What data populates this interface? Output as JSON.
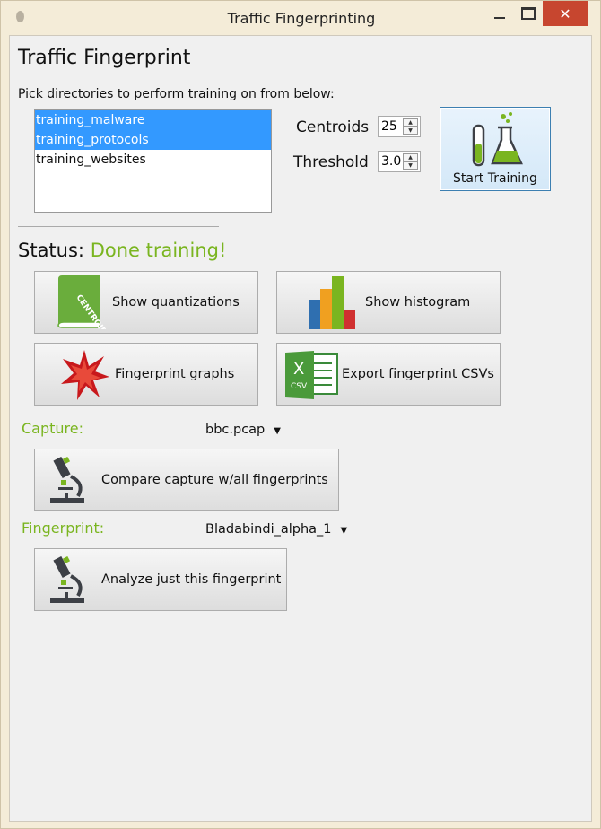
{
  "window": {
    "title": "Traffic Fingerprinting",
    "controls": {
      "minimize": "minimize",
      "maximize": "maximize",
      "close": "✕"
    }
  },
  "heading": "Traffic Fingerprint",
  "pick_label": "Pick directories to perform training on from below:",
  "directories": [
    {
      "label": "training_malware",
      "selected": true
    },
    {
      "label": "training_protocols",
      "selected": true
    },
    {
      "label": "training_websites",
      "selected": false
    }
  ],
  "centroids": {
    "label": "Centroids",
    "value": "25"
  },
  "threshold": {
    "label": "Threshold",
    "value": "3.0"
  },
  "start_training": {
    "label": "Start Training",
    "icon": "flask-icon"
  },
  "status": {
    "label": "Status:",
    "value": "Done training!"
  },
  "buttons": {
    "show_quantizations": {
      "label": "Show quantizations",
      "icon": "centroids-book-icon",
      "icon_text": "CENTROIDS"
    },
    "show_histogram": {
      "label": "Show histogram",
      "icon": "bar-chart-icon"
    },
    "fingerprint_graphs": {
      "label": "Fingerprint graphs",
      "icon": "star-graph-icon"
    },
    "export_csvs": {
      "label": "Export fingerprint CSVs",
      "icon": "excel-csv-icon",
      "icon_text": "X",
      "icon_subtext": "CSV"
    }
  },
  "capture": {
    "label": "Capture:",
    "selected": "bbc.pcap",
    "arrow": "▼"
  },
  "compare_button": {
    "label": "Compare capture w/all fingerprints",
    "icon": "microscope-icon"
  },
  "fingerprint": {
    "label": "Fingerprint:",
    "selected": "Bladabindi_alpha_1",
    "arrow": "▼"
  },
  "analyze_button": {
    "label": "Analyze just this fingerprint",
    "icon": "microscope-icon"
  },
  "colors": {
    "accent_green": "#7ab520",
    "selection_blue": "#3399ff",
    "close_red": "#c7462f"
  }
}
